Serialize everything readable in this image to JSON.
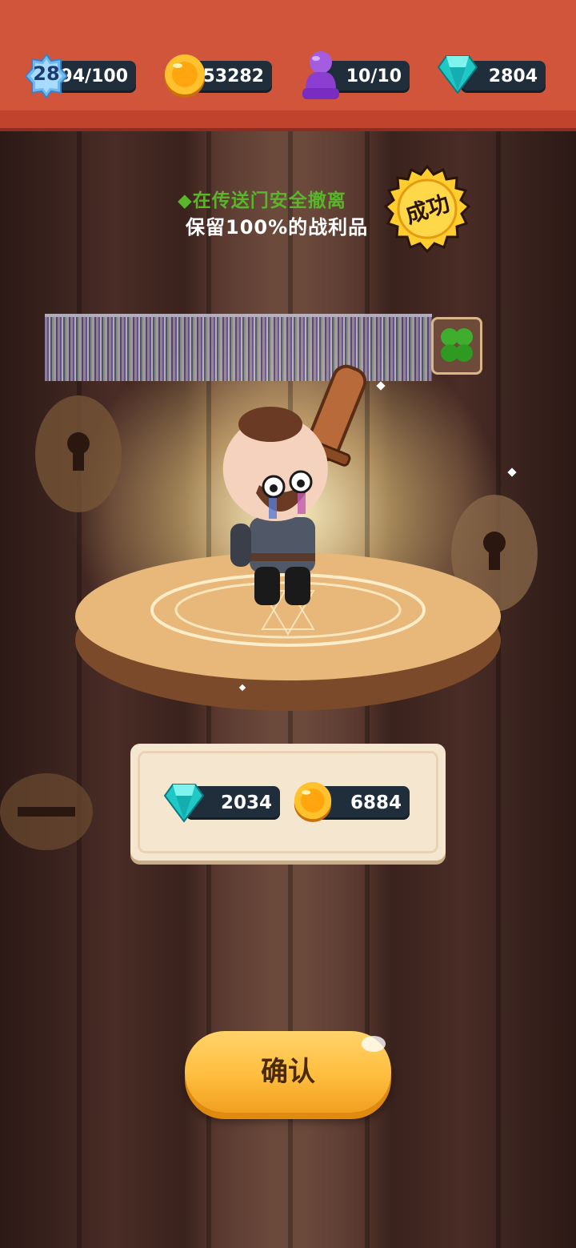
{
  "top_bar": {
    "level": "28",
    "energy": "94/100",
    "coins": "53282",
    "players": "10/10",
    "gems": "2804"
  },
  "result": {
    "line1": "◆在传送门安全撤离",
    "line2": "保留100%的战利品",
    "stamp": "成功"
  },
  "rewards": {
    "gems": "2034",
    "coins": "6884"
  },
  "confirm_label": "确认",
  "icons": {
    "level": "star-badge-icon",
    "coin": "coin-icon",
    "player": "player-pawn-icon",
    "gem": "gem-icon",
    "loot": "clover-loot-icon"
  },
  "colors": {
    "top_bar": "#d1553a",
    "headline_green": "#59b52a",
    "button": "#ffbd3e"
  }
}
